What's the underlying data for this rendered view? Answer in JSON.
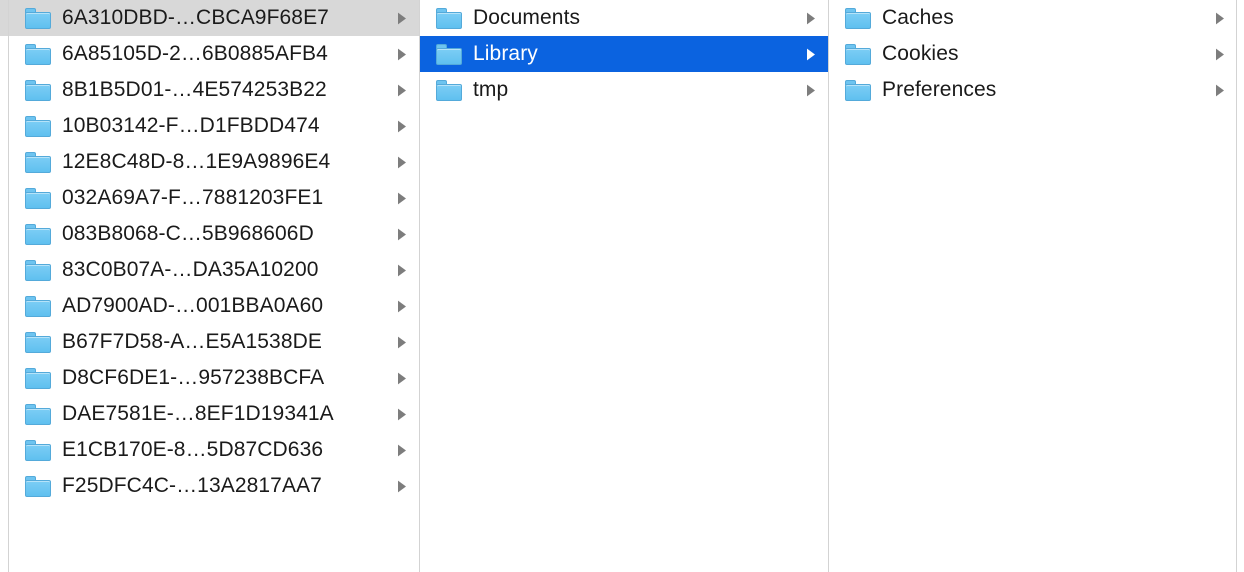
{
  "window": {
    "title": "Finder — Column View",
    "view_mode": "column",
    "colors": {
      "selection_active": "#0b63e0",
      "selection_inactive": "#d8d8d8",
      "folder_blue": "#6ec4f0",
      "divider": "#d3d3d3",
      "text": "#1a1a1a",
      "text_selected": "#ffffff",
      "chevron": "#7d7d7d",
      "background": "#ffffff"
    }
  },
  "columns": [
    {
      "name": "column-previous-clipped",
      "clipped": true,
      "items": [
        {
          "label": "",
          "icon": "folder-icon",
          "chevron": "chevron-right-icon",
          "state": "selected-inactive"
        },
        {
          "label": "",
          "icon": "folder-icon",
          "chevron": "chevron-right-icon",
          "state": "normal"
        },
        {
          "label": "",
          "icon": "folder-icon",
          "chevron": "chevron-right-icon",
          "state": "normal"
        }
      ]
    },
    {
      "name": "column-container-uuids",
      "clipped": false,
      "items": [
        {
          "label": "6A310DBD-…CBCA9F68E7",
          "icon": "folder-icon",
          "chevron": "chevron-right-icon",
          "state": "selected-inactive"
        },
        {
          "label": "6A85105D-2…6B0885AFB4",
          "icon": "folder-icon",
          "chevron": "chevron-right-icon",
          "state": "normal"
        },
        {
          "label": "8B1B5D01-…4E574253B22",
          "icon": "folder-icon",
          "chevron": "chevron-right-icon",
          "state": "normal"
        },
        {
          "label": "10B03142-F…D1FBDD474",
          "icon": "folder-icon",
          "chevron": "chevron-right-icon",
          "state": "normal"
        },
        {
          "label": "12E8C48D-8…1E9A9896E4",
          "icon": "folder-icon",
          "chevron": "chevron-right-icon",
          "state": "normal"
        },
        {
          "label": "032A69A7-F…7881203FE1",
          "icon": "folder-icon",
          "chevron": "chevron-right-icon",
          "state": "normal"
        },
        {
          "label": "083B8068-C…5B968606D",
          "icon": "folder-icon",
          "chevron": "chevron-right-icon",
          "state": "normal"
        },
        {
          "label": "83C0B07A-…DA35A10200",
          "icon": "folder-icon",
          "chevron": "chevron-right-icon",
          "state": "normal"
        },
        {
          "label": "AD7900AD-…001BBA0A60",
          "icon": "folder-icon",
          "chevron": "chevron-right-icon",
          "state": "normal"
        },
        {
          "label": "B67F7D58-A…E5A1538DE",
          "icon": "folder-icon",
          "chevron": "chevron-right-icon",
          "state": "normal"
        },
        {
          "label": "D8CF6DE1-…957238BCFA",
          "icon": "folder-icon",
          "chevron": "chevron-right-icon",
          "state": "normal"
        },
        {
          "label": "DAE7581E-…8EF1D19341A",
          "icon": "folder-icon",
          "chevron": "chevron-right-icon",
          "state": "normal"
        },
        {
          "label": "E1CB170E-8…5D87CD636",
          "icon": "folder-icon",
          "chevron": "chevron-right-icon",
          "state": "normal"
        },
        {
          "label": "F25DFC4C-…13A2817AA7",
          "icon": "folder-icon",
          "chevron": "chevron-right-icon",
          "state": "normal"
        }
      ]
    },
    {
      "name": "column-container-data",
      "clipped": false,
      "items": [
        {
          "label": "Documents",
          "icon": "folder-icon",
          "chevron": "chevron-right-icon",
          "state": "normal"
        },
        {
          "label": "Library",
          "icon": "folder-icon",
          "chevron": "chevron-right-icon",
          "state": "selected-active"
        },
        {
          "label": "tmp",
          "icon": "folder-icon",
          "chevron": "chevron-right-icon",
          "state": "normal"
        }
      ]
    },
    {
      "name": "column-library",
      "clipped": false,
      "items": [
        {
          "label": "Caches",
          "icon": "folder-icon",
          "chevron": "chevron-right-icon",
          "state": "normal"
        },
        {
          "label": "Cookies",
          "icon": "folder-icon",
          "chevron": "chevron-right-icon",
          "state": "normal"
        },
        {
          "label": "Preferences",
          "icon": "folder-icon",
          "chevron": "chevron-right-icon",
          "state": "normal"
        }
      ]
    }
  ]
}
